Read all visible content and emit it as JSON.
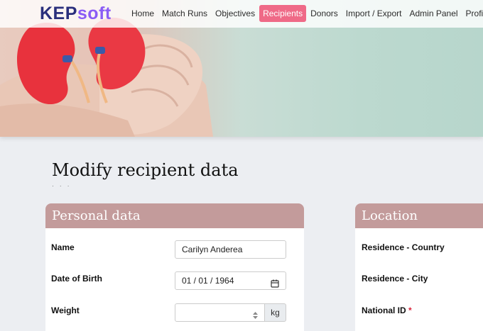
{
  "brand": {
    "part1": "KEP",
    "part2": "soft"
  },
  "nav": {
    "items": [
      {
        "label": "Home",
        "active": false
      },
      {
        "label": "Match Runs",
        "active": false
      },
      {
        "label": "Objectives",
        "active": false
      },
      {
        "label": "Recipients",
        "active": true
      },
      {
        "label": "Donors",
        "active": false
      },
      {
        "label": "Import / Export",
        "active": false
      },
      {
        "label": "Admin Panel",
        "active": false
      },
      {
        "label": "Profile",
        "active": false
      }
    ]
  },
  "page": {
    "title": "Modify recipient data",
    "subtitle": "· · ·"
  },
  "personal": {
    "header": "Personal data",
    "name_label": "Name",
    "name_value": "Carilyn Anderea",
    "dob_label": "Date of Birth",
    "dob_value": "01 / 01 / 1964",
    "weight_label": "Weight",
    "weight_value": "",
    "weight_unit": "kg"
  },
  "location": {
    "header": "Location",
    "country_label": "Residence - Country",
    "city_label": "Residence - City",
    "national_id_label": "National ID",
    "required_mark": "*"
  },
  "colors": {
    "accent": "#ef6a87",
    "card_header": "#c39b9b",
    "brand_dark": "#2a2f7c",
    "brand_light": "#8a5cf5"
  }
}
